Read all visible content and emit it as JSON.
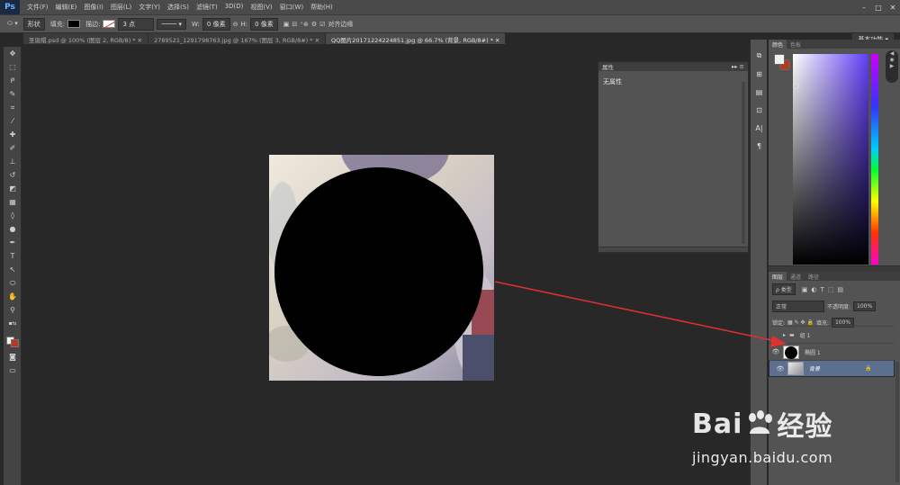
{
  "app": {
    "logo": "Ps"
  },
  "menu": [
    "文件(F)",
    "编辑(E)",
    "图像(I)",
    "图层(L)",
    "文字(Y)",
    "选择(S)",
    "滤镜(T)",
    "3D(D)",
    "视图(V)",
    "窗口(W)",
    "帮助(H)"
  ],
  "options": {
    "mode": "形状",
    "fill_label": "填充:",
    "stroke_label": "描边:",
    "stroke_size": "3 点",
    "w_label": "W:",
    "w_value": "0 像素",
    "h_label": "H:",
    "h_value": "0 像素",
    "align_edges": "对齐边缘",
    "workspace": "基本功能"
  },
  "tabs": [
    {
      "label": "圣诞帽.psd @ 100% (图层 2, RGB/8) *"
    },
    {
      "label": "2789521_1291798763.jpg @ 167% (图层 3, RGB/8#) *"
    },
    {
      "label": "QQ图片20171224224851.jpg @ 66.7% (背景, RGB/8#) *"
    }
  ],
  "properties": {
    "title": "属性",
    "content": "无属性"
  },
  "color_panel": {
    "tabs": [
      "颜色",
      "色板"
    ],
    "fg": "#f0f0f0",
    "bg": "#b5391f"
  },
  "layers_panel": {
    "tabs": [
      "图层",
      "通道",
      "路径"
    ],
    "kind": "ρ 类型",
    "blend": "正常",
    "opacity_label": "不透明度:",
    "opacity": "100%",
    "lock_label": "锁定:",
    "fill_label": "填充:",
    "fill": "100%",
    "layers": [
      {
        "name": "组 1"
      },
      {
        "name": "椭圆 1"
      },
      {
        "name": "背景"
      }
    ]
  },
  "watermark": {
    "brand": "Bai",
    "brand2": "经验",
    "url": "jingyan.baidu.com"
  },
  "colors": {
    "accent_arrow": "#e03030",
    "selected_layer": "#5b6f8f"
  }
}
